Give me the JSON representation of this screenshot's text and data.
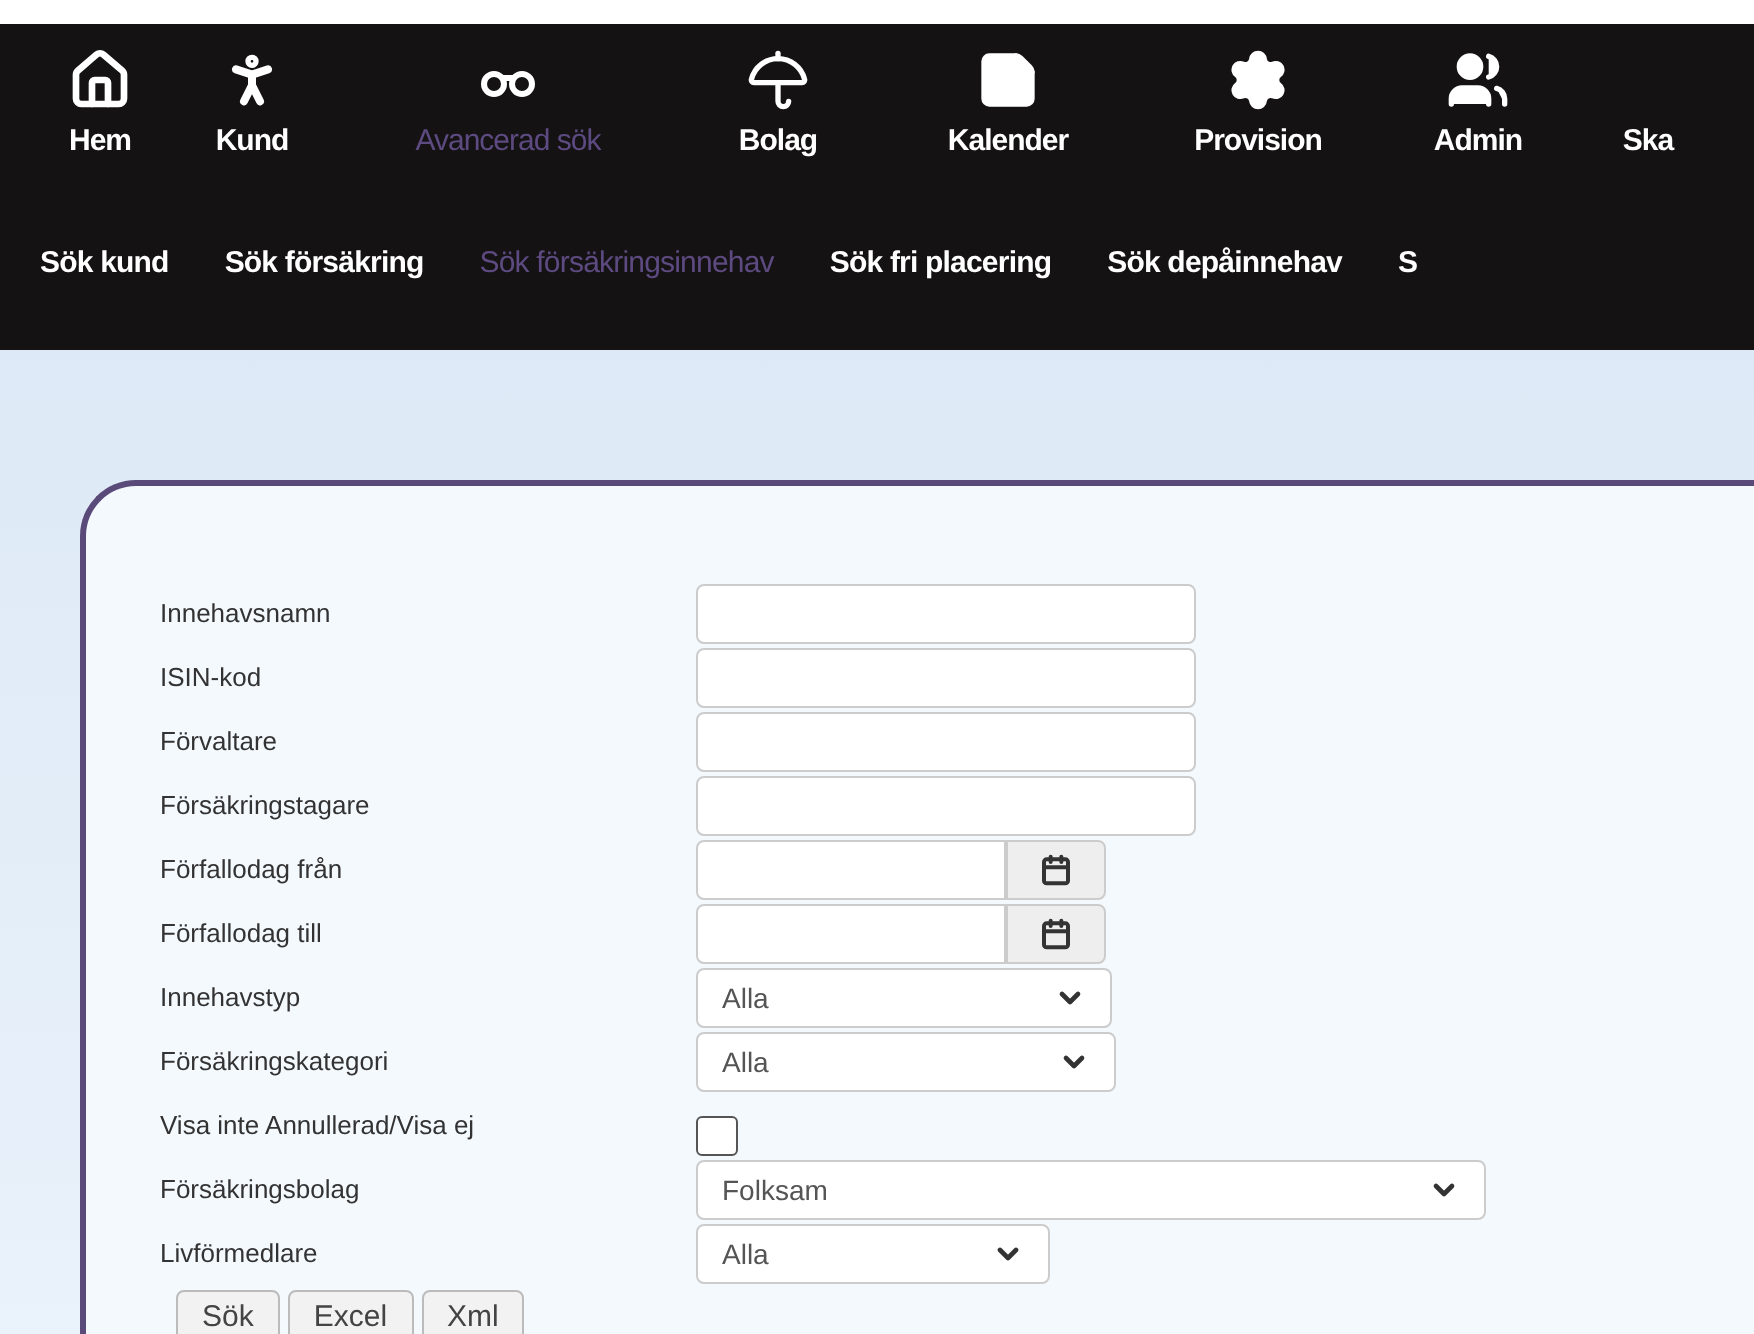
{
  "main_nav": [
    {
      "label": "Hem",
      "selected": false
    },
    {
      "label": "Kund",
      "selected": false
    },
    {
      "label": "Avancerad sök",
      "selected": true
    },
    {
      "label": "Bolag",
      "selected": false
    },
    {
      "label": "Kalender",
      "selected": false
    },
    {
      "label": "Provision",
      "selected": false
    },
    {
      "label": "Admin",
      "selected": false
    },
    {
      "label": "Ska",
      "selected": false
    }
  ],
  "sub_nav": [
    {
      "label": "Sök kund",
      "selected": false
    },
    {
      "label": "Sök försäkring",
      "selected": false
    },
    {
      "label": "Sök försäkringsinnehav",
      "selected": true
    },
    {
      "label": "Sök fri placering",
      "selected": false
    },
    {
      "label": "Sök depåinnehav",
      "selected": false
    },
    {
      "label": "S",
      "selected": false
    }
  ],
  "form": {
    "fields": [
      {
        "label": "Innehavsnamn",
        "kind": "text"
      },
      {
        "label": "ISIN-kod",
        "kind": "text"
      },
      {
        "label": "Förvaltare",
        "kind": "text"
      },
      {
        "label": "Försäkringstagare",
        "kind": "text"
      },
      {
        "label": "Förfallodag från",
        "kind": "date"
      },
      {
        "label": "Förfallodag till",
        "kind": "date"
      },
      {
        "label": "Innehavstyp",
        "kind": "select",
        "value": "Alla"
      },
      {
        "label": "Försäkringskategori",
        "kind": "select",
        "value": "Alla"
      },
      {
        "label": "Visa inte Annullerad/Visa ej",
        "kind": "checkbox",
        "checked": false
      },
      {
        "label": "Försäkringsbolag",
        "kind": "select",
        "value": "Folksam"
      },
      {
        "label": "Livförmedlare",
        "kind": "select",
        "value": "Alla"
      }
    ],
    "buttons": [
      "Sök",
      "Excel",
      "Xml"
    ]
  }
}
